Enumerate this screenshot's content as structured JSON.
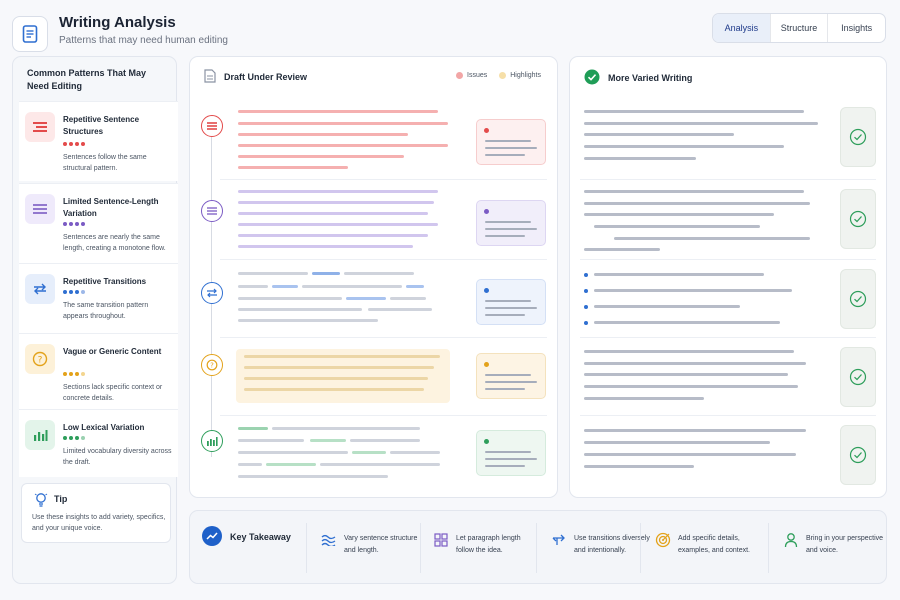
{
  "header": {
    "title": "Writing Analysis",
    "subtitle": "Patterns that may need human editing",
    "tabs": [
      "Analysis",
      "Structure",
      "Insights"
    ]
  },
  "sidebar": {
    "title": "Common Patterns That May Need Editing",
    "patterns": [
      {
        "name": "Repetitive Sentence Structures",
        "desc": "Sentences follow the same structural pattern.",
        "icon": "lines-icon",
        "color": "#e34b4b"
      },
      {
        "name": "Limited Sentence-Length Variation",
        "desc": "Sentences are nearly the same length, creating a monotone flow.",
        "icon": "equal-lines-icon",
        "color": "#7b5bc4"
      },
      {
        "name": "Repetitive Transitions",
        "desc": "The same transition pattern appears throughout.",
        "icon": "arrows-icon",
        "color": "#2f6fd1"
      },
      {
        "name": "Vague or Generic Content",
        "desc": "Sections lack specific context or concrete details.",
        "icon": "question-icon",
        "color": "#e3a21a"
      },
      {
        "name": "Low Lexical Variation",
        "desc": "Limited vocabulary diversity across the draft.",
        "icon": "bar-chart-icon",
        "color": "#2e9e5b"
      }
    ],
    "tip": {
      "title": "Tip",
      "desc": "Use these insights to add variety, specifics, and your unique voice."
    }
  },
  "draft": {
    "title": "Draft Under Review",
    "legend": [
      {
        "label": "Issues",
        "color": "#f2a6a6"
      },
      {
        "label": "Highlights",
        "color": "#f6dfa8"
      }
    ]
  },
  "varied": {
    "title": "More Varied Writing"
  },
  "takeaway": {
    "title": "Key Takeaway",
    "items": [
      {
        "text": "Vary sentence structure and length.",
        "icon": "wave-icon",
        "color": "#2f6fd1"
      },
      {
        "text": "Let paragraph length follow the idea.",
        "icon": "grid-icon",
        "color": "#7b5bc4"
      },
      {
        "text": "Use transitions diversely and intentionally.",
        "icon": "arrows-icon",
        "color": "#2f6fd1"
      },
      {
        "text": "Add specific details, examples, and context.",
        "icon": "target-icon",
        "color": "#e3a21a"
      },
      {
        "text": "Bring in your perspective and voice.",
        "icon": "person-icon",
        "color": "#2e9e5b"
      }
    ]
  }
}
